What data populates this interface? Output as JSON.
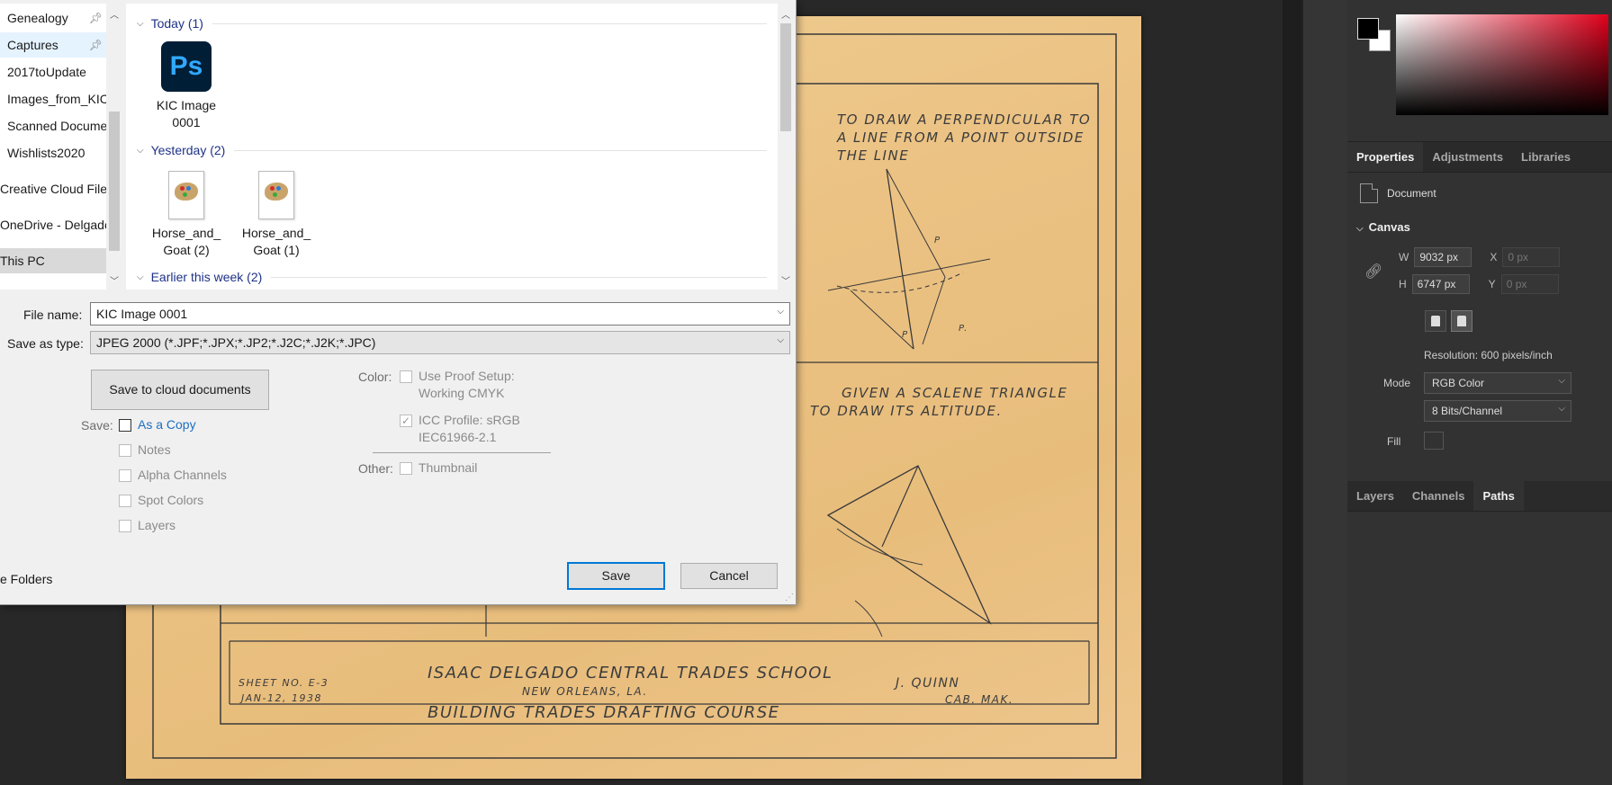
{
  "nav": {
    "items": [
      {
        "label": "Genealogy",
        "pinned": true
      },
      {
        "label": "Captures",
        "pinned": true
      },
      {
        "label": "2017toUpdate",
        "pinned": false
      },
      {
        "label": "Images_from_KIC",
        "pinned": false
      },
      {
        "label": "Scanned Documents",
        "pinned": false
      },
      {
        "label": "Wishlists2020",
        "pinned": false
      },
      {
        "label": "Creative Cloud Files",
        "pinned": false
      },
      {
        "label": "OneDrive - Delgado",
        "pinned": false
      },
      {
        "label": "This PC",
        "pinned": false
      }
    ],
    "hide_folders": "e Folders"
  },
  "files": {
    "groups": [
      {
        "label": "Today (1)"
      },
      {
        "label": "Yesterday (2)"
      },
      {
        "label": "Earlier this week (2)"
      }
    ],
    "items": [
      {
        "name_line1": "KIC Image",
        "name_line2": "0001",
        "icon": "photoshop-icon",
        "icon_text": "Ps"
      },
      {
        "name_line1": "Horse_and_",
        "name_line2": "Goat (2)",
        "icon": "paint-file-icon"
      },
      {
        "name_line1": "Horse_and_",
        "name_line2": "Goat (1)",
        "icon": "paint-file-icon"
      }
    ]
  },
  "form": {
    "file_name_label": "File name:",
    "file_name_value": "KIC Image 0001",
    "save_type_label": "Save as type:",
    "save_type_value": "JPEG 2000 (*.JPF;*.JPX;*.JP2;*.J2C;*.J2K;*.JPC)"
  },
  "options": {
    "cloud_button": "Save to cloud documents",
    "save_label": "Save:",
    "as_copy": "As a Copy",
    "notes": "Notes",
    "alpha_channels": "Alpha Channels",
    "spot_colors": "Spot Colors",
    "layers": "Layers",
    "color_label": "Color:",
    "use_proof_line1": "Use Proof Setup:",
    "use_proof_line2": "Working CMYK",
    "icc_line1": "ICC Profile:  sRGB",
    "icc_line2": "IEC61966-2.1",
    "other_label": "Other:",
    "thumbnail": "Thumbnail",
    "save_button": "Save",
    "cancel_button": "Cancel"
  },
  "drawing": {
    "top_text_1": "TO DRAW A PERPENDICULAR TO",
    "top_text_2": "A LINE FROM A POINT OUTSIDE",
    "top_text_3": "THE LINE",
    "mid_text_1": "GIVEN A SCALENE TRIANGLE",
    "mid_text_2": "TO DRAW ITS ALTITUDE.",
    "sheet_no": "SHEET NO. E-3",
    "sheet_date": "JAN-12, 1938",
    "school": "ISAAC DELGADO CENTRAL TRADES SCHOOL",
    "city": "NEW ORLEANS, LA.",
    "course": "BUILDING TRADES DRAFTING COURSE",
    "author": "J. QUINN",
    "author_sub": "CAB. MAK.",
    "label_p1": "P",
    "label_p2": "P.",
    "label_p3": "P"
  },
  "properties": {
    "tabs": [
      "Properties",
      "Adjustments",
      "Libraries"
    ],
    "active_tab": "Properties",
    "document_label": "Document",
    "canvas_label": "Canvas",
    "w_label": "W",
    "w_value": "9032 px",
    "h_label": "H",
    "h_value": "6747 px",
    "x_label": "X",
    "x_placeholder": "0 px",
    "y_label": "Y",
    "y_placeholder": "0 px",
    "resolution": "Resolution: 600 pixels/inch",
    "mode_label": "Mode",
    "mode_value": "RGB Color",
    "depth_value": "8 Bits/Channel",
    "fill_label": "Fill"
  },
  "layers_panel": {
    "tabs": [
      "Layers",
      "Channels",
      "Paths"
    ],
    "active_tab": "Paths"
  },
  "colors": {
    "accent": "#0078d7",
    "foreground": "#000000",
    "background": "#ffffff",
    "group_header": "#1e3287"
  }
}
